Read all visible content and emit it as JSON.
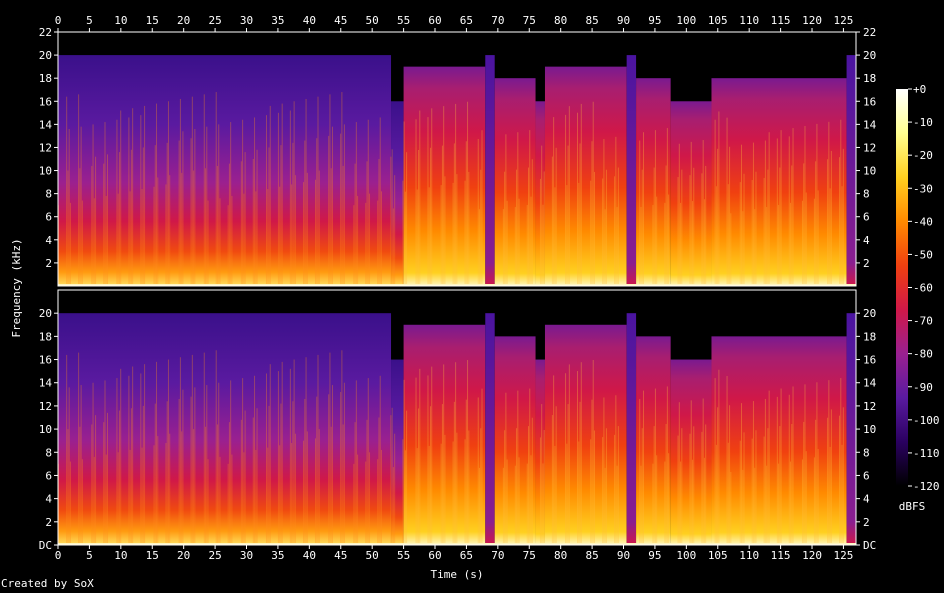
{
  "chart_data": {
    "type": "heatmap",
    "title": "",
    "xlabel": "Time (s)",
    "ylabel": "Frequency (kHz)",
    "xlim": [
      0,
      127
    ],
    "ylim": [
      0,
      22
    ],
    "x_ticks": [
      0,
      5,
      10,
      15,
      20,
      25,
      30,
      35,
      40,
      45,
      50,
      55,
      60,
      65,
      70,
      75,
      80,
      85,
      90,
      95,
      100,
      105,
      110,
      115,
      120,
      125
    ],
    "y_ticks_top": [
      "2",
      "4",
      "6",
      "8",
      "10",
      "12",
      "14",
      "16",
      "18",
      "20",
      "22"
    ],
    "y_ticks_bottom": [
      "DC",
      "2",
      "4",
      "6",
      "8",
      "10",
      "12",
      "14",
      "16",
      "18",
      "20"
    ],
    "channels": 2,
    "colorbar": {
      "label": "dBFS",
      "ticks": [
        "+0",
        "-10",
        "-20",
        "-30",
        "-40",
        "-50",
        "-60",
        "-70",
        "-80",
        "-90",
        "-100",
        "-110",
        "-120"
      ],
      "range": [
        -120,
        0
      ]
    },
    "segments": [
      {
        "start": 0,
        "end": 53,
        "cutoff_khz": 20,
        "level": "low"
      },
      {
        "start": 53,
        "end": 55,
        "cutoff_khz": 16,
        "level": "low"
      },
      {
        "start": 55,
        "end": 68,
        "cutoff_khz": 19,
        "level": "high"
      },
      {
        "start": 68,
        "end": 69.5,
        "cutoff_khz": 20,
        "level": "gap"
      },
      {
        "start": 69.5,
        "end": 76,
        "cutoff_khz": 18,
        "level": "high"
      },
      {
        "start": 76,
        "end": 77.5,
        "cutoff_khz": 16,
        "level": "high"
      },
      {
        "start": 77.5,
        "end": 90.5,
        "cutoff_khz": 19,
        "level": "high"
      },
      {
        "start": 90.5,
        "end": 92,
        "cutoff_khz": 20,
        "level": "gap"
      },
      {
        "start": 92,
        "end": 97.5,
        "cutoff_khz": 18,
        "level": "high"
      },
      {
        "start": 97.5,
        "end": 104,
        "cutoff_khz": 16,
        "level": "high"
      },
      {
        "start": 104,
        "end": 125.5,
        "cutoff_khz": 18,
        "level": "high"
      },
      {
        "start": 125.5,
        "end": 127,
        "cutoff_khz": 20,
        "level": "gap"
      }
    ]
  },
  "footer": {
    "credit": "Created by SoX"
  },
  "colors": {
    "background": "#000000",
    "axis": "#ffffff",
    "colormap": [
      "#000000",
      "#2a0060",
      "#5a1aa0",
      "#9a2090",
      "#d01848",
      "#f04010",
      "#ff8a00",
      "#ffd020",
      "#ffff90",
      "#ffffff"
    ]
  }
}
